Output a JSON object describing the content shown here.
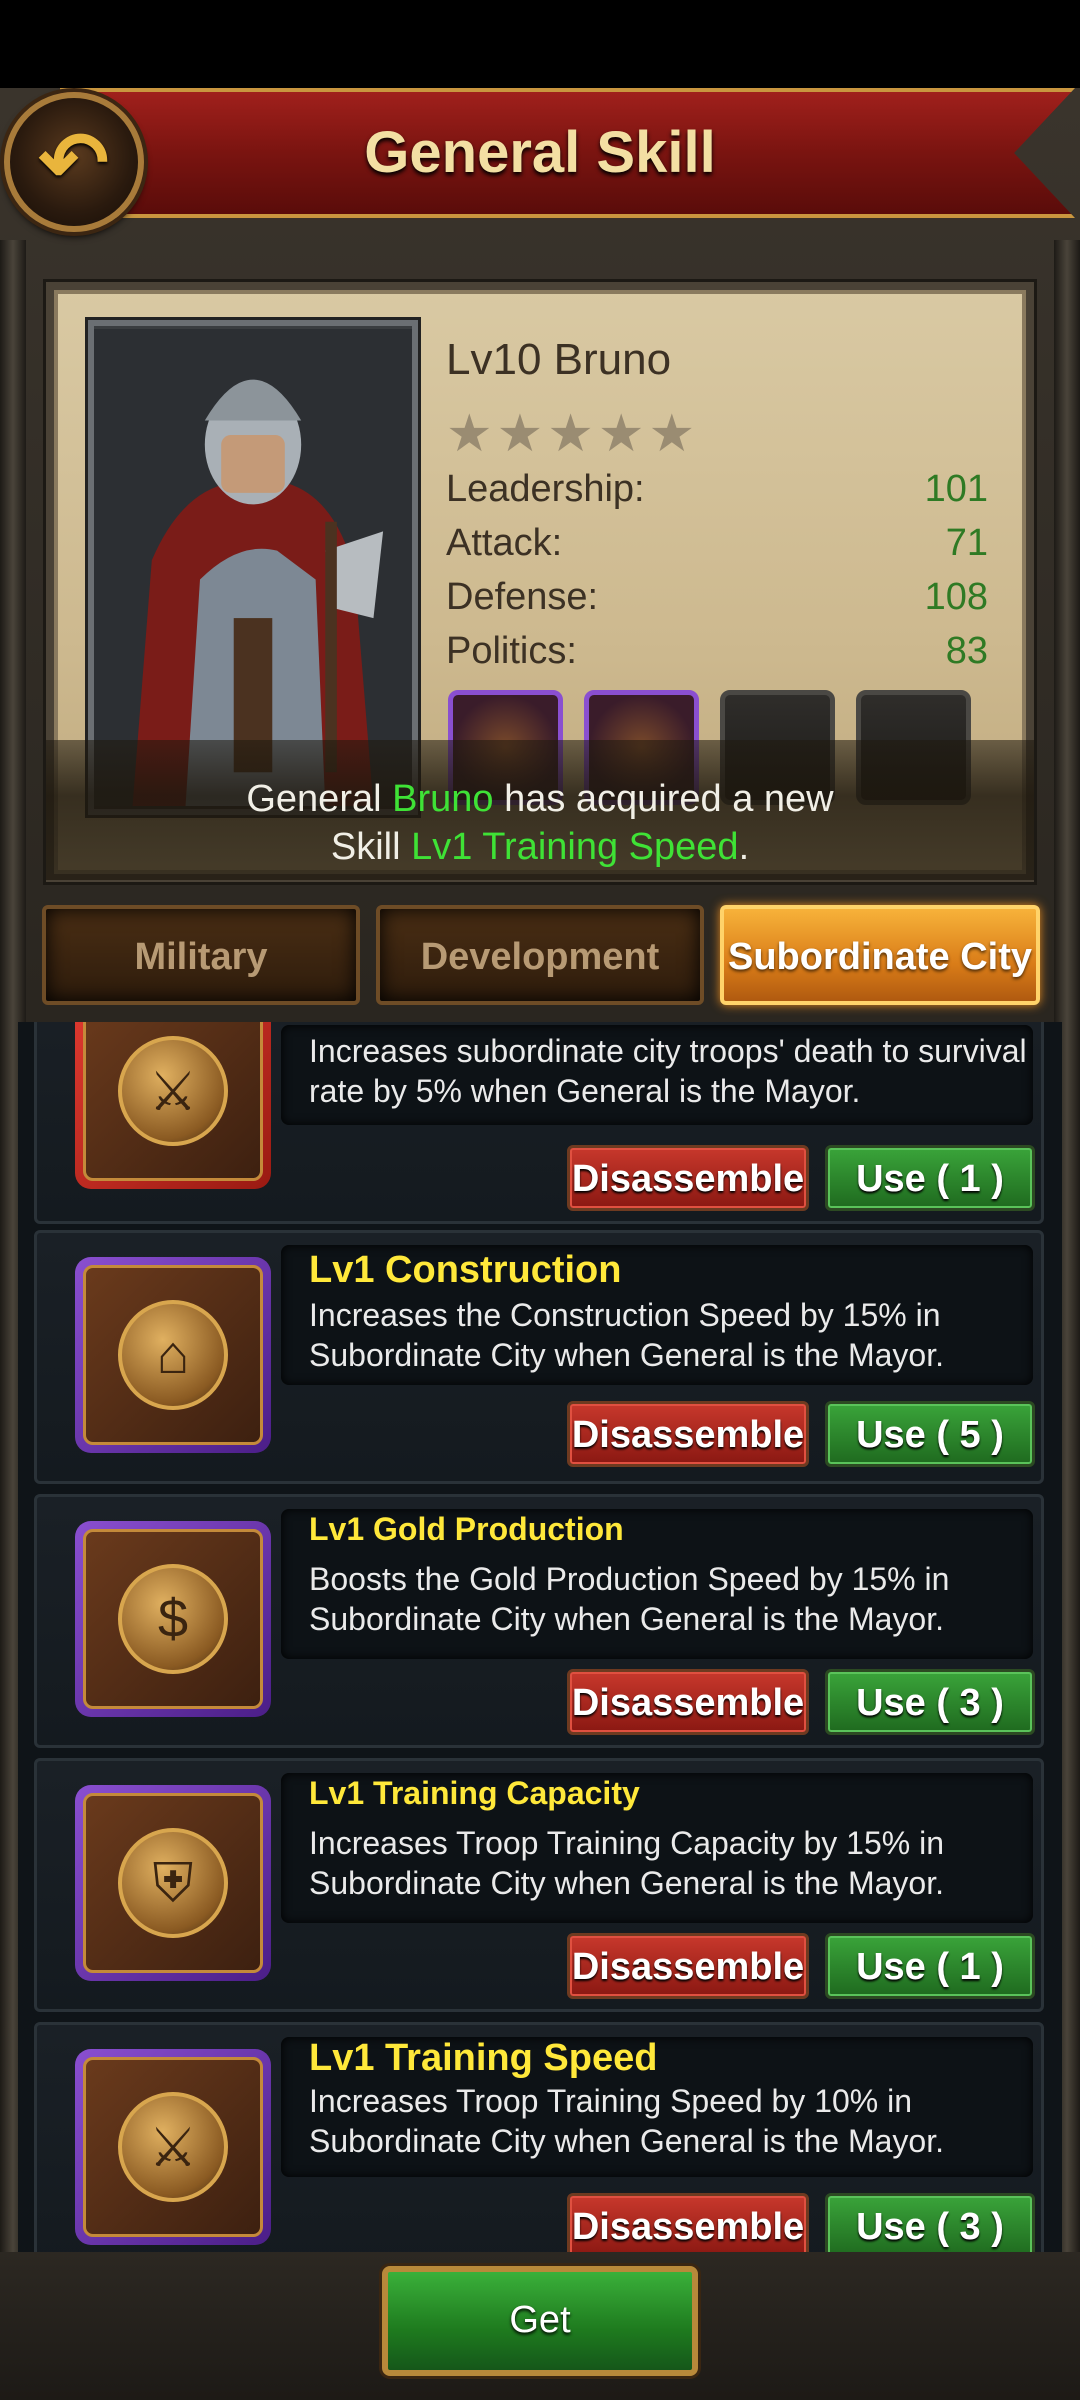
{
  "header": {
    "title": "General Skill",
    "back_icon": "back-arrow-icon"
  },
  "general": {
    "name": "Lv10 Bruno",
    "stars": "★★★★★",
    "stats": [
      {
        "label": "Leadership:",
        "value": "101"
      },
      {
        "label": "Attack:",
        "value": "71"
      },
      {
        "label": "Defense:",
        "value": "108"
      },
      {
        "label": "Politics:",
        "value": "83"
      }
    ],
    "skill_slots": [
      "filled",
      "filled",
      "empty",
      "empty"
    ]
  },
  "notice": {
    "prefix": "General ",
    "name": "Bruno",
    "middle": " has acquired a new",
    "line2_prefix": "Skill ",
    "skill": "Lv1 Training Speed",
    "suffix": "."
  },
  "tabs": [
    {
      "label": "Military",
      "active": false
    },
    {
      "label": "Development",
      "active": false
    },
    {
      "label": "Subordinate City",
      "active": true
    }
  ],
  "skills": [
    {
      "title": "",
      "description": "Increases subordinate city troops' death to survival rate by 5% when General is the Mayor.",
      "disassemble": "Disassemble",
      "use": "Use ( 1 )",
      "rarity": "red"
    },
    {
      "title": "Lv1 Construction",
      "description": "Increases the Construction Speed by 15% in Subordinate City when General is the Mayor.",
      "disassemble": "Disassemble",
      "use": "Use ( 5 )",
      "rarity": "purple"
    },
    {
      "title": "Lv1 Gold Production",
      "description": "Boosts the Gold Production Speed by 15% in Subordinate City when General is the Mayor.",
      "disassemble": "Disassemble",
      "use": "Use ( 3 )",
      "rarity": "purple"
    },
    {
      "title": "Lv1 Training Capacity",
      "description": "Increases Troop Training Capacity by 15% in Subordinate City when General is the Mayor.",
      "disassemble": "Disassemble",
      "use": "Use ( 1 )",
      "rarity": "purple"
    },
    {
      "title": "Lv1 Training Speed",
      "description": "Increases Troop Training Speed by 10% in Subordinate City when General is the Mayor.",
      "disassemble": "Disassemble",
      "use": "Use ( 3 )",
      "rarity": "purple"
    }
  ],
  "footer": {
    "get_label": "Get"
  },
  "colors": {
    "accent_green": "#3fe236",
    "title_gold": "#f3dfa3",
    "skill_yellow": "#ffe83a"
  }
}
